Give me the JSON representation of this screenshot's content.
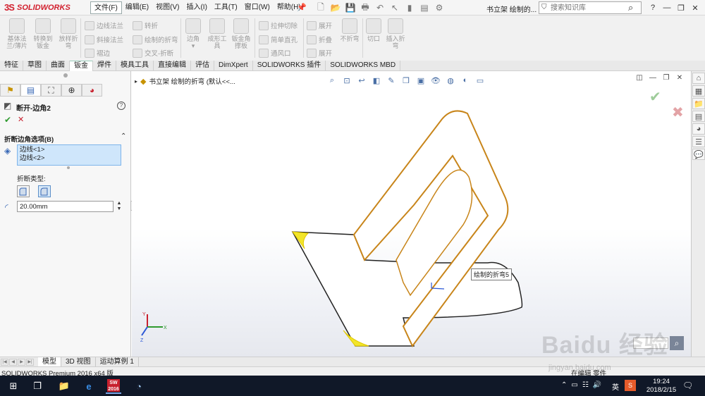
{
  "app": {
    "logo_mark": "3S",
    "logo_text": "SOLIDWORKS",
    "document_title": "书立架 绘制的...",
    "search_placeholder": "搜索知识库"
  },
  "menu": [
    "文件(F)",
    "编辑(E)",
    "视图(V)",
    "插入(I)",
    "工具(T)",
    "窗口(W)",
    "帮助(H)"
  ],
  "ribbon": {
    "buttons": [
      {
        "label": "基体法\n兰/薄片"
      },
      {
        "label": "转换到\n钣金"
      },
      {
        "label": "放样折\n弯"
      },
      {
        "label": "边角"
      },
      {
        "label": "成形工\n具"
      },
      {
        "label": "钣金角\n撑板"
      },
      {
        "label": "不折弯"
      },
      {
        "label": "切口"
      },
      {
        "label": "插入折\n弯"
      }
    ],
    "small": [
      "边线法兰",
      "转折",
      "斜接法兰",
      "绘制的折弯",
      "褶边",
      "交叉-折断",
      "拉伸切除",
      "简单直孔",
      "通风口",
      "展开",
      "折叠",
      "展开"
    ]
  },
  "tabs": [
    "特征",
    "草图",
    "曲面",
    "钣金",
    "焊件",
    "模具工具",
    "直接编辑",
    "评估",
    "DimXpert",
    "SOLIDWORKS 插件",
    "SOLIDWORKS MBD"
  ],
  "active_tab": "钣金",
  "property_manager": {
    "title": "断开-边角2",
    "group_title": "折断边角选项(B)",
    "edges": [
      "边线<1>",
      "边线<2>"
    ],
    "break_type_label": "折断类型:",
    "radius_value": "20.00mm"
  },
  "graphics": {
    "tree_path": "书立架 绘制的折弯 (默认<<...",
    "callout": "绘制的折弯5",
    "accent_color": "#c8851a"
  },
  "bottom_tabs": [
    "模型",
    "3D 视图",
    "运动算例 1"
  ],
  "status": {
    "left": "SOLIDWORKS Premium 2016 x64 版",
    "right": "在编辑 零件"
  },
  "taskbar": {
    "ime": "英",
    "time": "19:24",
    "date": "2018/2/15"
  },
  "watermark": {
    "main": "Baidu 经验",
    "url": "jingyan.baidu.com"
  }
}
